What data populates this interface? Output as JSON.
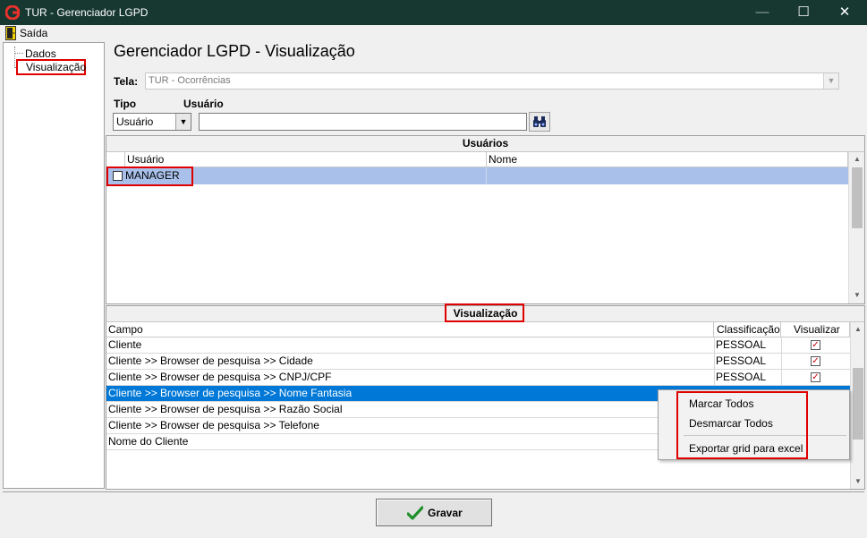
{
  "window": {
    "title": "TUR - Gerenciador LGPD",
    "minimize_glyph": "—",
    "maximize_glyph": "☐",
    "close_glyph": "✕"
  },
  "menu": {
    "exit_label": "Saída"
  },
  "tree": {
    "items": [
      {
        "label": "Dados"
      },
      {
        "label": "Visualização"
      }
    ]
  },
  "header": {
    "title": "Gerenciador LGPD - Visualização",
    "tela_label": "Tela:",
    "tela_value": "TUR - Ocorrências"
  },
  "filters": {
    "tipo_label": "Tipo",
    "usuario_label": "Usuário",
    "tipo_value": "Usuário",
    "usuario_value": ""
  },
  "users_grid": {
    "title": "Usuários",
    "columns": [
      "Usuário",
      "Nome"
    ],
    "rows": [
      {
        "usuario": "MANAGER",
        "nome": "",
        "checked": false
      }
    ]
  },
  "vis_grid": {
    "title": "Visualização",
    "columns": [
      "Campo",
      "Classificação",
      "Visualizar"
    ],
    "rows": [
      {
        "campo": "Cliente",
        "classificacao": "PESSOAL",
        "visualizar": true
      },
      {
        "campo": "Cliente >> Browser de pesquisa >> Cidade",
        "classificacao": "PESSOAL",
        "visualizar": true
      },
      {
        "campo": "Cliente >> Browser de pesquisa >> CNPJ/CPF",
        "classificacao": "PESSOAL",
        "visualizar": true
      },
      {
        "campo": "Cliente >> Browser de pesquisa >> Nome Fantasia",
        "classificacao": "",
        "visualizar": false,
        "selected": true
      },
      {
        "campo": "Cliente >> Browser de pesquisa >> Razão Social",
        "classificacao": "",
        "visualizar": false
      },
      {
        "campo": "Cliente >> Browser de pesquisa >> Telefone",
        "classificacao": "",
        "visualizar": false
      },
      {
        "campo": "Nome do Cliente",
        "classificacao": "",
        "visualizar": false
      }
    ]
  },
  "context_menu": {
    "items": [
      {
        "label": "Marcar Todos"
      },
      {
        "label": "Desmarcar Todos"
      },
      {
        "label": "Exportar grid para excel"
      }
    ]
  },
  "footer": {
    "save_label": "Gravar"
  },
  "colors": {
    "titlebar": "#173831",
    "selection": "#0078d7",
    "user_row": "#a9c1ea",
    "highlight_box": "#e00000",
    "check": "#d00000"
  }
}
